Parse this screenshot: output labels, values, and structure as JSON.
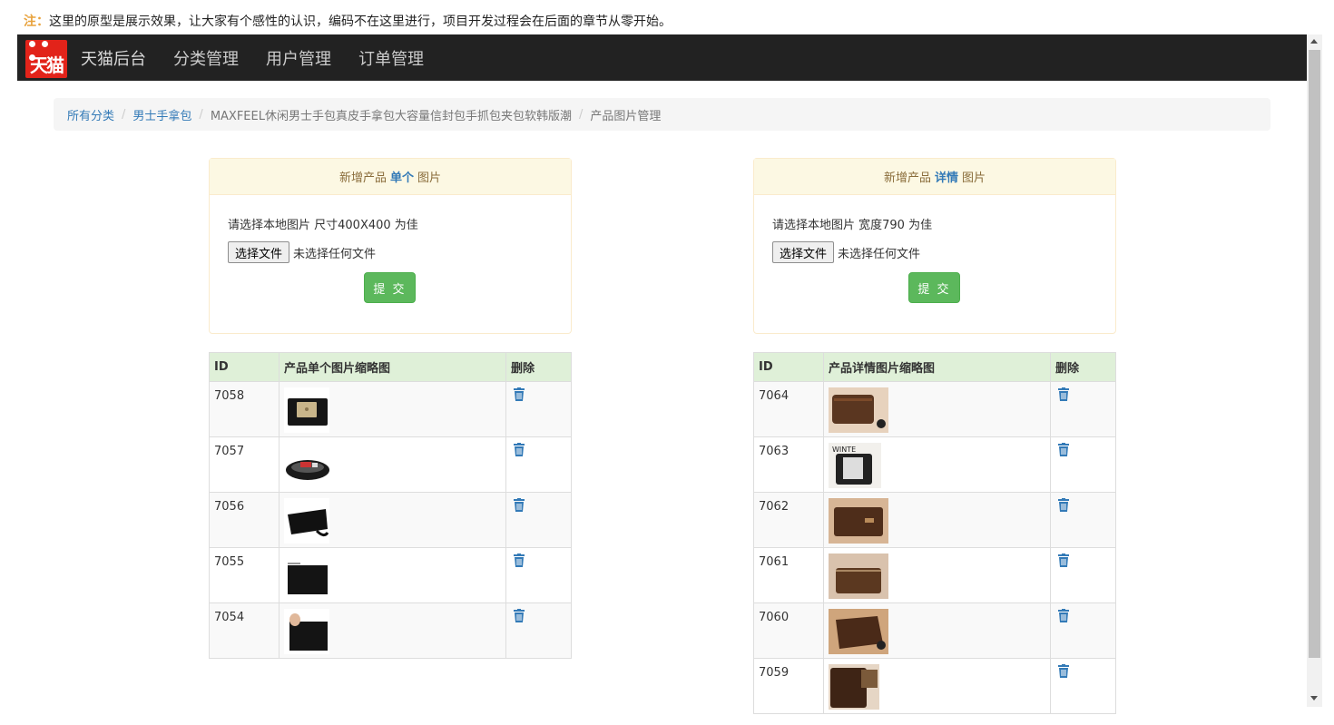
{
  "note": {
    "prefix": "注：",
    "text": "这里的原型是展示效果，让大家有个感性的认识，编码不在这里进行，项目开发过程会在后面的章节从零开始。"
  },
  "navbar": {
    "logo_text": "天猫",
    "items": [
      "天猫后台",
      "分类管理",
      "用户管理",
      "订单管理"
    ]
  },
  "breadcrumb": {
    "items": [
      "所有分类",
      "男士手拿包",
      "MAXFEEL休闲男士手包真皮手拿包大容量信封包手抓包夹包软韩版潮",
      "产品图片管理"
    ],
    "separator": "/"
  },
  "upload_single": {
    "heading_prefix": "新增产品",
    "heading_type": "单个",
    "heading_suffix": "图片",
    "hint": "请选择本地图片 尺寸400X400 为佳",
    "file_button": "选择文件",
    "file_status": "未选择任何文件",
    "submit": "提 交"
  },
  "upload_detail": {
    "heading_prefix": "新增产品",
    "heading_type": "详情",
    "heading_suffix": "图片",
    "hint": "请选择本地图片 宽度790 为佳",
    "file_button": "选择文件",
    "file_status": "未选择任何文件",
    "submit": "提 交"
  },
  "single_table": {
    "headers": [
      "ID",
      "产品单个图片缩略图",
      "删除"
    ],
    "rows": [
      {
        "id": "7058",
        "thumb": "black-clutch-with-tablet"
      },
      {
        "id": "7057",
        "thumb": "open-black-clutch"
      },
      {
        "id": "7056",
        "thumb": "black-clutch-with-strap"
      },
      {
        "id": "7055",
        "thumb": "black-envelope-clutch"
      },
      {
        "id": "7054",
        "thumb": "hand-holding-clutch"
      }
    ]
  },
  "detail_table": {
    "headers": [
      "ID",
      "产品详情图片缩略图",
      "删除"
    ],
    "rows": [
      {
        "id": "7064",
        "thumb": "brown-wallet"
      },
      {
        "id": "7063",
        "thumb": "black-wallet-with-phone"
      },
      {
        "id": "7062",
        "thumb": "brown-wallet-closed"
      },
      {
        "id": "7061",
        "thumb": "brown-wallet-zipper"
      },
      {
        "id": "7060",
        "thumb": "brown-wallet-angle"
      },
      {
        "id": "7059",
        "thumb": "brown-wallet-partial"
      }
    ]
  },
  "colors": {
    "navbar_bg": "#222222",
    "link": "#337ab7",
    "submit_bg": "#5cb85c",
    "table_head_bg": "#dff0d8",
    "panel_head_bg": "#fcf8e3"
  }
}
